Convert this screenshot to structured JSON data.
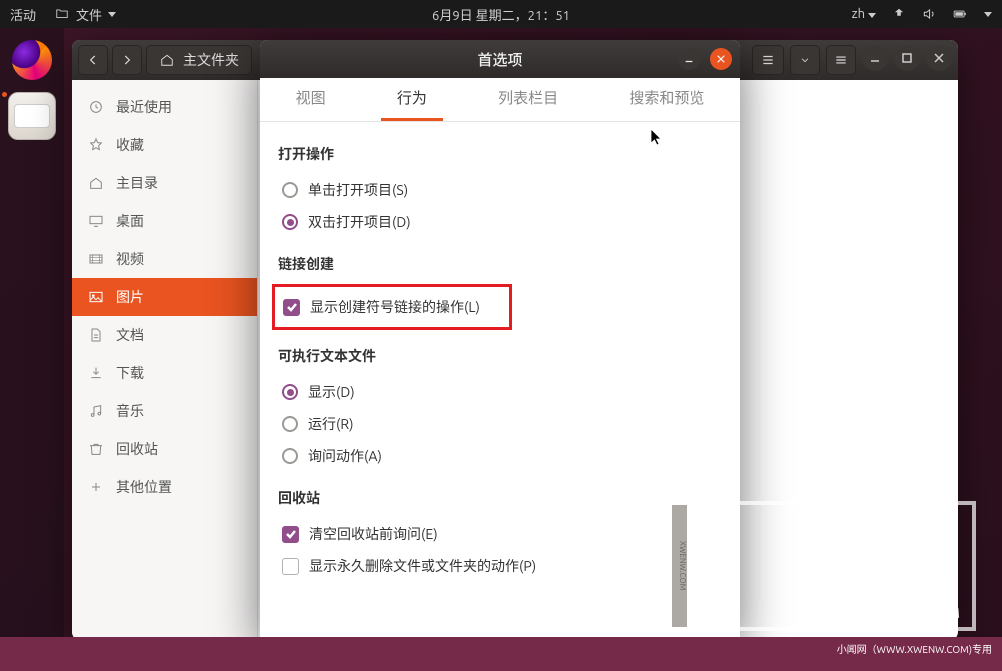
{
  "topbar": {
    "activities": "活动",
    "files_label": "文件",
    "datetime": "6月9日 星期二，21：51",
    "lang": "zh"
  },
  "window": {
    "path_label": "主文件夹"
  },
  "sidebar": {
    "items": [
      {
        "label": "最近使用"
      },
      {
        "label": "收藏"
      },
      {
        "label": "主目录"
      },
      {
        "label": "桌面"
      },
      {
        "label": "视频"
      },
      {
        "label": "图片"
      },
      {
        "label": "文档"
      },
      {
        "label": "下载"
      },
      {
        "label": "音乐"
      },
      {
        "label": "回收站"
      },
      {
        "label": "其他位置"
      }
    ]
  },
  "prefs": {
    "title": "首选项",
    "tabs": {
      "view": "视图",
      "behavior": "行为",
      "list_columns": "列表栏目",
      "search_preview": "搜索和预览"
    },
    "groups": {
      "open_action": {
        "title": "打开操作",
        "single_click": "单击打开项目(S)",
        "double_click": "双击打开项目(D)"
      },
      "link_creation": {
        "title": "链接创建",
        "show_symlink_action": "显示创建符号链接的操作(L)"
      },
      "executable": {
        "title": "可执行文本文件",
        "display": "显示(D)",
        "run": "运行(R)",
        "ask": "询问动作(A)"
      },
      "trash": {
        "title": "回收站",
        "confirm_empty": "清空回收站前询问(E)",
        "perm_delete": "显示永久删除文件或文件夹的动作(P)"
      }
    }
  },
  "watermark": {
    "url_tag": "小闻网（WWW.XWENW.COM)专用",
    "logo_sub": "XWENW.COM",
    "side": "XWENW.COM"
  }
}
